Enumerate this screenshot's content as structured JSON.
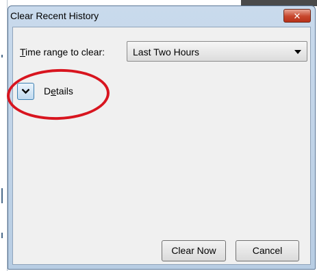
{
  "window": {
    "title": "Clear Recent History",
    "close_glyph": "✕"
  },
  "time_range": {
    "label": "Time range to clear:",
    "label_accelerator": "T",
    "label_rest": "ime range to clear:",
    "selected": "Last Two Hours"
  },
  "details": {
    "label": "Details",
    "label_pre": "D",
    "label_accelerator": "e",
    "label_rest": "tails",
    "expanded": false
  },
  "buttons": {
    "clear_now": "Clear Now",
    "cancel": "Cancel"
  },
  "annotation": {
    "color": "#d8151f"
  },
  "icons": {
    "close": "close-icon",
    "select_arrow": "chevron-down-icon",
    "details_toggle": "chevron-down-icon"
  }
}
